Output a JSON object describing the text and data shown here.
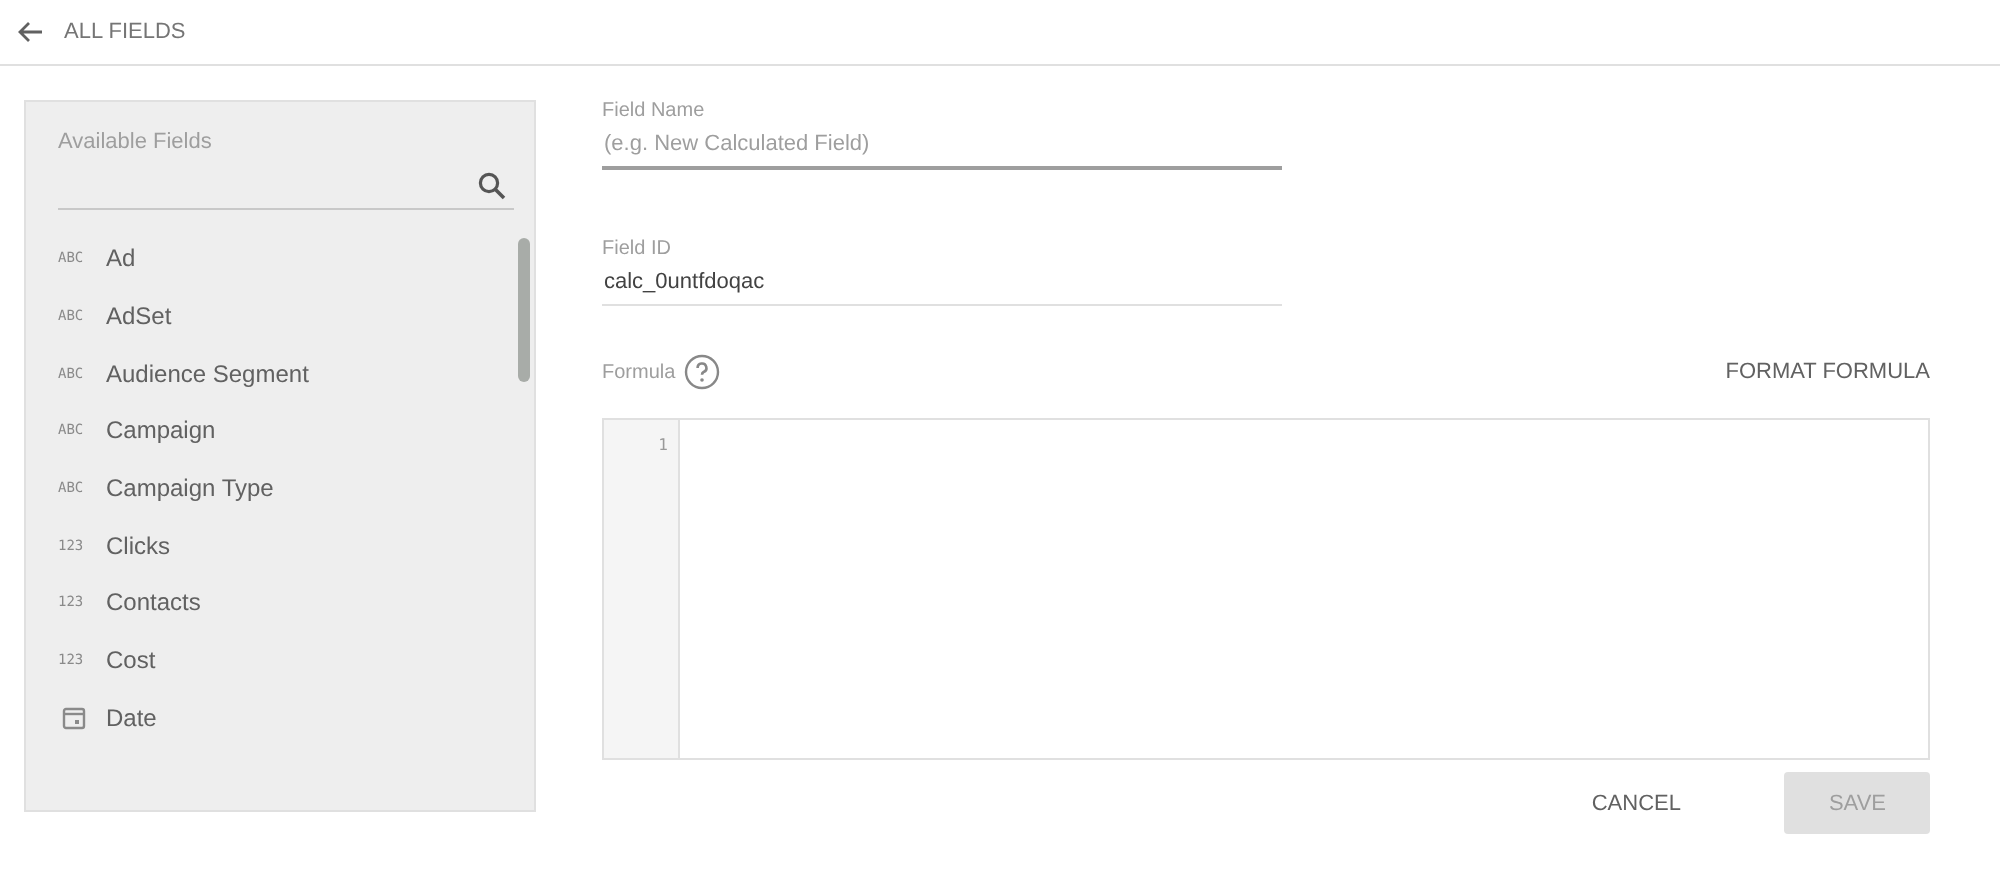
{
  "header": {
    "back_label": "ALL FIELDS"
  },
  "available_fields": {
    "title": "Available Fields",
    "items": [
      {
        "kind": "text",
        "type_label": "ABC",
        "label": "Ad"
      },
      {
        "kind": "text",
        "type_label": "ABC",
        "label": "AdSet"
      },
      {
        "kind": "text",
        "type_label": "ABC",
        "label": "Audience Segment"
      },
      {
        "kind": "text",
        "type_label": "ABC",
        "label": "Campaign"
      },
      {
        "kind": "text",
        "type_label": "ABC",
        "label": "Campaign Type"
      },
      {
        "kind": "number",
        "type_label": "123",
        "label": "Clicks"
      },
      {
        "kind": "number",
        "type_label": "123",
        "label": "Contacts"
      },
      {
        "kind": "number",
        "type_label": "123",
        "label": "Cost"
      },
      {
        "kind": "date",
        "label": "Date"
      }
    ]
  },
  "field_name": {
    "label": "Field Name",
    "placeholder": "(e.g. New Calculated Field)"
  },
  "field_id": {
    "label": "Field ID",
    "value": "calc_0untfdoqac"
  },
  "formula": {
    "label": "Formula",
    "format_button": "FORMAT FORMULA",
    "line_numbers": [
      "1"
    ]
  },
  "buttons": [
    {
      "label": "CANCEL",
      "kind": "text",
      "disabled": false
    },
    {
      "label": "SAVE",
      "kind": "filled",
      "disabled": true
    }
  ]
}
